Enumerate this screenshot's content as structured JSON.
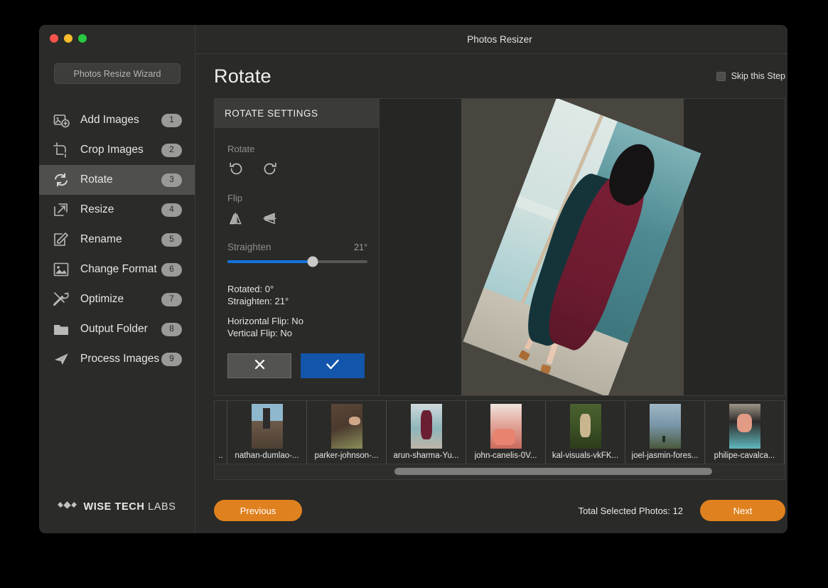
{
  "window": {
    "title": "Photos Resizer",
    "traffic_lights": [
      "close-red",
      "minimize-yellow",
      "zoom-green"
    ]
  },
  "sidebar": {
    "wizard_button": "Photos Resize Wizard",
    "items": [
      {
        "label": "Add Images",
        "badge": "1",
        "icon": "add-images-icon",
        "active": false
      },
      {
        "label": "Crop Images",
        "badge": "2",
        "icon": "crop-icon",
        "active": false
      },
      {
        "label": "Rotate",
        "badge": "3",
        "icon": "rotate-icon",
        "active": true
      },
      {
        "label": "Resize",
        "badge": "4",
        "icon": "resize-icon",
        "active": false
      },
      {
        "label": "Rename",
        "badge": "5",
        "icon": "rename-icon",
        "active": false
      },
      {
        "label": "Change Format",
        "badge": "6",
        "icon": "image-format-icon",
        "active": false
      },
      {
        "label": "Optimize",
        "badge": "7",
        "icon": "tools-icon",
        "active": false
      },
      {
        "label": "Output Folder",
        "badge": "8",
        "icon": "folder-icon",
        "active": false
      },
      {
        "label": "Process Images",
        "badge": "9",
        "icon": "paper-plane-icon",
        "active": false
      }
    ],
    "brand": {
      "bold": "WISE TECH",
      "light": "LABS",
      "logo": "wise-tech-labs-logo"
    }
  },
  "page": {
    "title": "Rotate",
    "skip_label": "Skip this Step",
    "skip_checked": false
  },
  "settings": {
    "header": "ROTATE SETTINGS",
    "rotate_label": "Rotate",
    "rotate_left_icon": "rotate-counterclockwise-icon",
    "rotate_right_icon": "rotate-clockwise-icon",
    "flip_label": "Flip",
    "flip_horizontal_icon": "flip-horizontal-icon",
    "flip_vertical_icon": "flip-vertical-icon",
    "straighten_label": "Straighten",
    "straighten_value": "21°",
    "straighten_percent": 61,
    "status": {
      "rotated": "Rotated: 0°",
      "straighten": "Straighten: 21°",
      "horizontal_flip": "Horizontal Flip: No",
      "vertical_flip": "Vertical Flip: No"
    },
    "cancel_icon": "close-x-icon",
    "apply_icon": "check-icon",
    "accent_blue": "#1275e0",
    "apply_blue": "#1255ab"
  },
  "preview": {
    "rotation_degrees": 21,
    "alt": "woman-in-maroon-coat-photo"
  },
  "thumbnails": {
    "items": [
      {
        "name": "..",
        "art": "t-partial",
        "partial": true
      },
      {
        "name": "nathan-dumlao-...",
        "art": "t0"
      },
      {
        "name": "parker-johnson-...",
        "art": "t1"
      },
      {
        "name": "arun-sharma-Yu...",
        "art": "t2"
      },
      {
        "name": "john-canelis-0V...",
        "art": "t3"
      },
      {
        "name": "kal-visuals-vkFK...",
        "art": "t4"
      },
      {
        "name": "joel-jasmin-fores...",
        "art": "t5"
      },
      {
        "name": "philipe-cavalca...",
        "art": "t6"
      }
    ]
  },
  "footer": {
    "previous_label": "Previous",
    "next_label": "Next",
    "total_text": "Total Selected Photos: 12",
    "accent_orange": "#e0811f"
  }
}
